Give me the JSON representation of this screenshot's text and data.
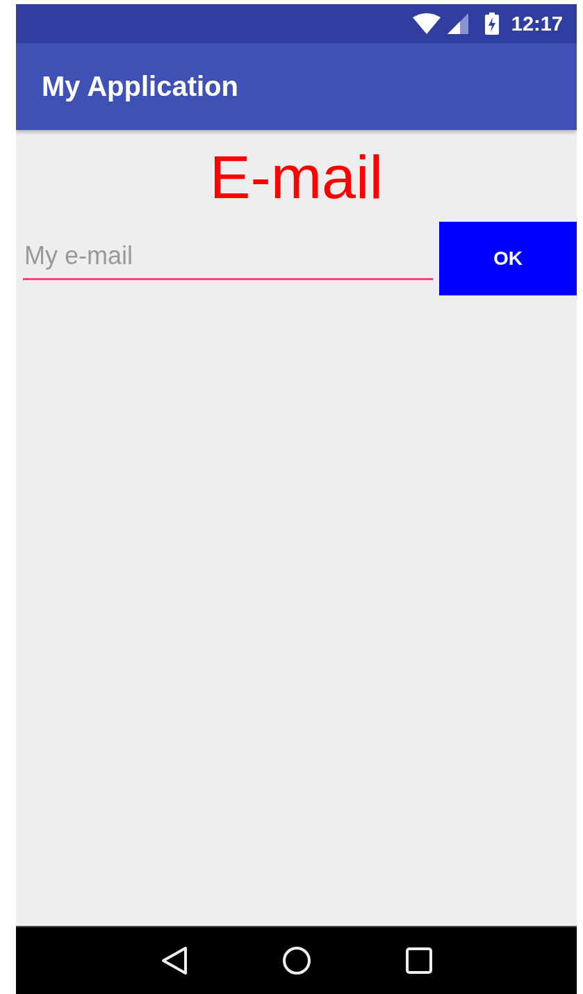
{
  "status_bar": {
    "time": "12:17"
  },
  "app_bar": {
    "title": "My Application"
  },
  "heading": "E-mail",
  "email_field": {
    "placeholder": "My e-mail"
  },
  "ok_button": {
    "label": "OK"
  }
}
